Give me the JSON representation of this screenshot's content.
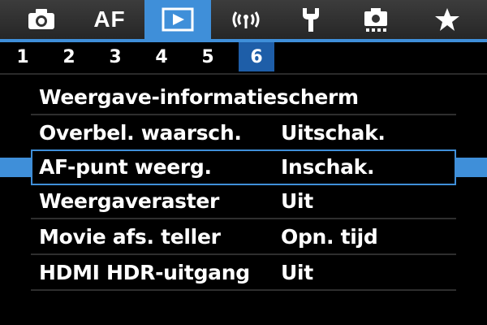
{
  "tabs": [
    {
      "icon": "camera-icon",
      "label": ""
    },
    {
      "icon": "af-icon",
      "label": "AF"
    },
    {
      "icon": "playback-icon",
      "label": "",
      "active": true
    },
    {
      "icon": "wireless-icon",
      "label": ""
    },
    {
      "icon": "wrench-icon",
      "label": ""
    },
    {
      "icon": "custom-functions-icon",
      "label": ""
    },
    {
      "icon": "star-icon",
      "label": ""
    }
  ],
  "subtabs": [
    "1",
    "2",
    "3",
    "4",
    "5",
    "6"
  ],
  "active_subtab": "6",
  "menu": {
    "items": [
      {
        "label": "Weergave-informatiescherm",
        "value": ""
      },
      {
        "label": "Overbel. waarsch.",
        "value": "Uitschak."
      },
      {
        "label": "AF-punt weerg.",
        "value": "Inschak.",
        "selected": true
      },
      {
        "label": "Weergaveraster",
        "value": "Uit"
      },
      {
        "label": "Movie afs. teller",
        "value": "Opn. tijd"
      },
      {
        "label": "HDMI HDR-uitgang",
        "value": "Uit"
      }
    ]
  },
  "colors": {
    "accent": "#3f8fd9",
    "subtab_active": "#1e5ea8",
    "background": "#000000"
  }
}
